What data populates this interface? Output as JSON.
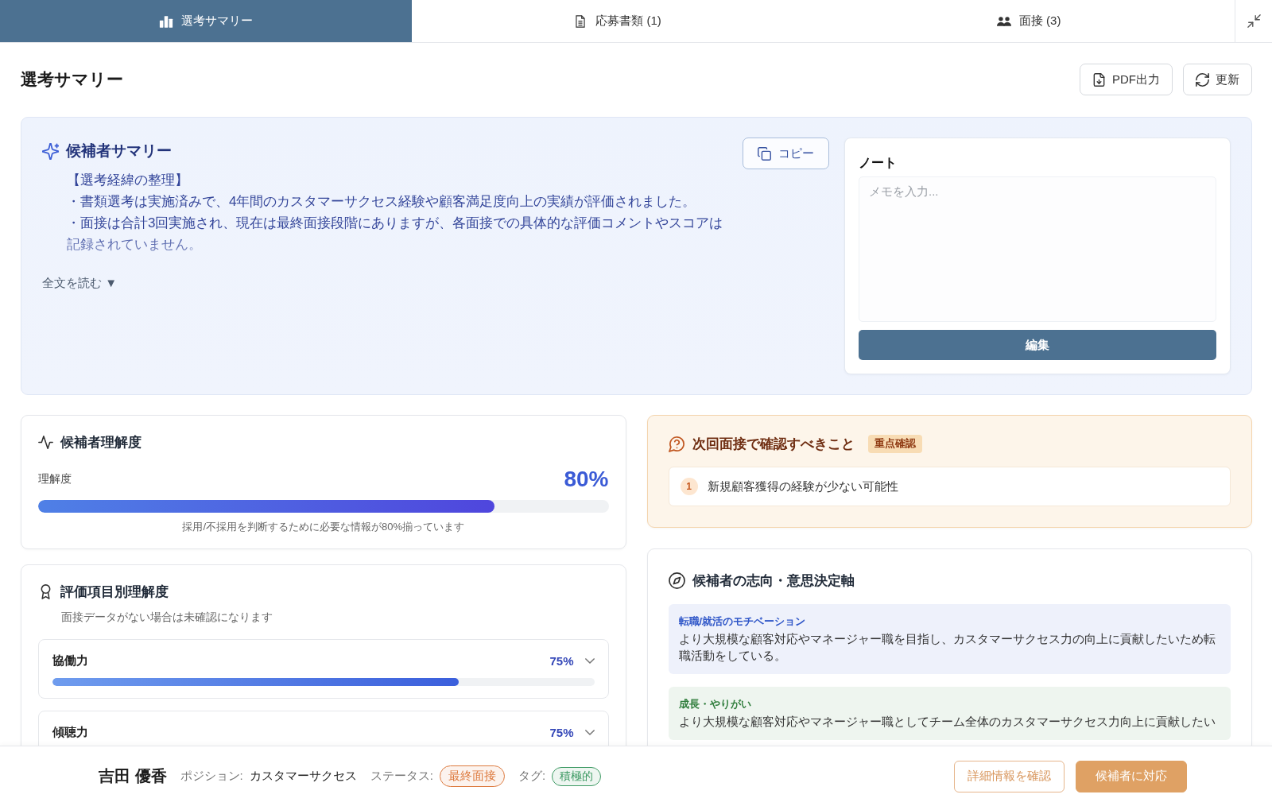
{
  "tabs": [
    {
      "label": "選考サマリー",
      "selected": true
    },
    {
      "label": "応募書類 (1)",
      "selected": false
    },
    {
      "label": "面接 (3)",
      "selected": false
    }
  ],
  "page": {
    "title": "選考サマリー",
    "actions": [
      "PDF出力",
      "更新"
    ]
  },
  "summary": {
    "title": "候補者サマリー",
    "copy_label": "コピー",
    "body": [
      "【選考経緯の整理】",
      "・書類選考は実施済みで、4年間のカスタマーサクセス経験や顧客満足度向上の実績が評価されました。",
      "・面接は合計3回実施され、現在は最終面接段階にありますが、各面接での具体的な評価コメントやスコアは記録されていません。"
    ],
    "read_more": "全文を読む ▼"
  },
  "note": {
    "title": "ノート",
    "placeholder": "メモを入力...",
    "button": "編集"
  },
  "understanding": {
    "title": "候補者理解度",
    "label": "理解度",
    "value": "80%",
    "level": 0.8,
    "caption": "採用/不採用を判断するために必要な情報が80%揃っています"
  },
  "criteria": {
    "title": "評価項目別理解度",
    "subtitle": "面接データがない場合は未確認になります",
    "items": [
      {
        "name": "協働力",
        "value": "75%",
        "level": 0.75,
        "expanded": false
      },
      {
        "name": "傾聴力",
        "value": "75%",
        "expanded": false
      }
    ]
  },
  "next_interview": {
    "title": "次回面接で確認すべきこと",
    "badge": "重点確認",
    "items": [
      {
        "number": "1",
        "text": "新規顧客獲得の経験が少ない可能性"
      }
    ]
  },
  "orientation": {
    "title": "候補者の志向・意思決定軸",
    "items": [
      {
        "label": "転職/就活のモチベーション",
        "text": "より大規模な顧客対応やマネージャー職を目指し、カスタマーサクセス力の向上に貢献したいため転職活動をしている。",
        "color": "#2f56c8"
      },
      {
        "label": "成長・やりがい",
        "text": "より大規模な顧客対応やマネージャー職としてチーム全体のカスタマーサクセス力向上に貢献したい",
        "color": "#2f7d3c"
      }
    ]
  },
  "footer": {
    "name": "吉田 優香",
    "meta": [
      {
        "kind": "text",
        "label": "ポジション:",
        "value": "カスタマーサクセス"
      },
      {
        "kind": "status",
        "label": "ステータス:",
        "value": "最終面接",
        "color": "#dd7a3e"
      },
      {
        "kind": "tag",
        "label": "タグ:",
        "value": "積極的",
        "color": "#3e9a64"
      }
    ],
    "buttons": [
      {
        "kind": "outline",
        "label": "詳細情報を確認"
      },
      {
        "kind": "primary",
        "label": "候補者に対応"
      }
    ]
  }
}
